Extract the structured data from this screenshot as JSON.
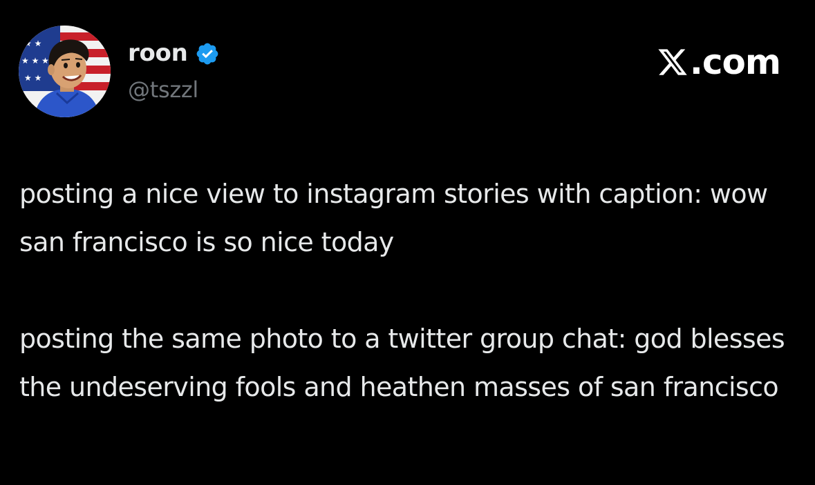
{
  "author": {
    "name": "roon",
    "handle": "@tszzl",
    "verified": true,
    "avatar_icon": "cartoon-boy-flag-avatar"
  },
  "site": {
    "label": ".com",
    "logo_icon": "x-logo-icon"
  },
  "tweet": {
    "paragraphs": [
      "posting a nice view to instagram stories with caption: wow san francisco is so nice today",
      "posting the same photo to a twitter group chat: god blesses the undeserving fools and heathen masses of san francisco"
    ]
  },
  "colors": {
    "background": "#000000",
    "text": "#e7e9ea",
    "handle": "#71767b",
    "verified": "#1d9bf0"
  }
}
